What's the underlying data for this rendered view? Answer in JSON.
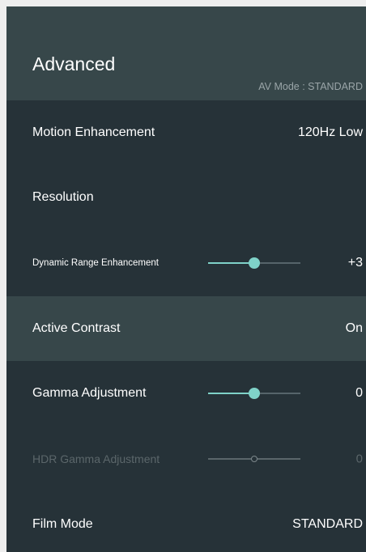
{
  "header": {
    "title": "Advanced",
    "av_mode": "AV Mode : STANDARD"
  },
  "colors": {
    "panel_bg": "#263238",
    "header_bg": "#37474a",
    "accent": "#7fd2c8",
    "disabled_text": "#5b666a"
  },
  "rows": [
    {
      "label": "Motion Enhancement",
      "value": "120Hz Low"
    },
    {
      "label": "Resolution",
      "value": ""
    },
    {
      "label": "Dynamic Range Enhancement",
      "value": "+3",
      "slider_fraction": 0.5
    },
    {
      "label": "Active Contrast",
      "value": "On",
      "selected": true
    },
    {
      "label": "Gamma Adjustment",
      "value": "0",
      "slider_fraction": 0.5
    },
    {
      "label": "HDR Gamma Adjustment",
      "value": "0",
      "slider_fraction": 0.5,
      "disabled": true
    },
    {
      "label": "Film Mode",
      "value": "STANDARD"
    }
  ]
}
